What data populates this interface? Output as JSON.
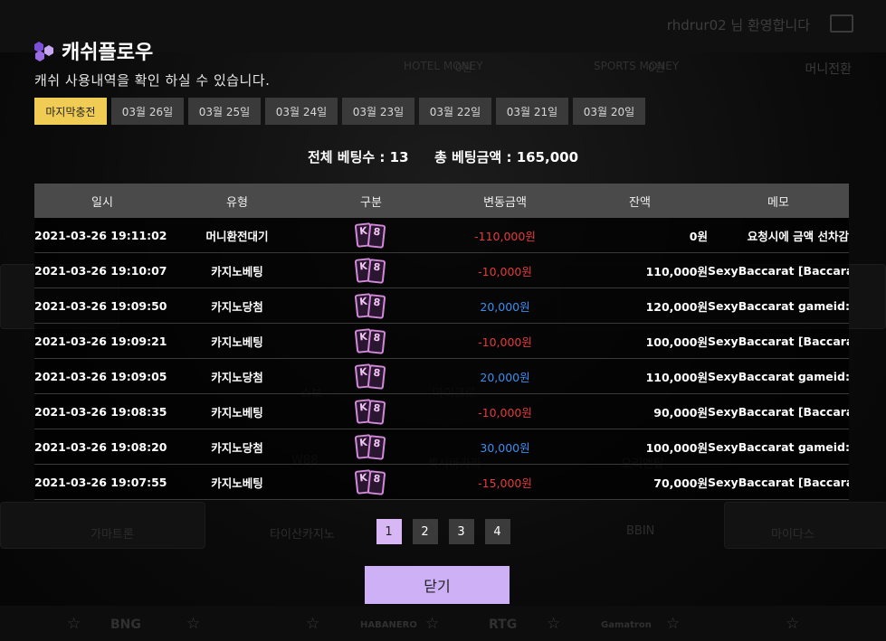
{
  "background": {
    "welcome": "rhdrur02 님 환영합니다",
    "wallets": [
      "HOTEL MONEY",
      "0원",
      "SPORTS MONEY",
      "0원"
    ],
    "exchange": "머니전환",
    "tiles": [
      "스보",
      "마이크로",
      "W88",
      "섹시바카라",
      "오리엔탈",
      "가마트론",
      "타이산카지노",
      "BBIN",
      "마이다스"
    ],
    "footer_logos": [
      "BNG",
      "HABANERO",
      "RTG",
      "Gamatron"
    ]
  },
  "modal": {
    "title": "캐쉬플로우",
    "subtitle": "캐쉬 사용내역을 확인 하실 수 있습니다.",
    "tabs": [
      {
        "label": "마지막충전",
        "active": true
      },
      {
        "label": "03월 26일"
      },
      {
        "label": "03월 25일"
      },
      {
        "label": "03월 24일"
      },
      {
        "label": "03월 23일"
      },
      {
        "label": "03월 22일"
      },
      {
        "label": "03월 21일"
      },
      {
        "label": "03월 20일"
      }
    ],
    "summary": {
      "bet_count_label": "전체 베팅수 :",
      "bet_count": "13",
      "bet_total_label": "총 베팅금액 :",
      "bet_total": "165,000"
    },
    "table": {
      "headers": [
        "일시",
        "유형",
        "구분",
        "변동금액",
        "잔액",
        "메모"
      ],
      "rows": [
        {
          "date": "2021-03-26 19:11:02",
          "type": "머니환전대기",
          "amount": "-110,000원",
          "sign": "neg",
          "balance": "0원",
          "memo": "요청시에 금액 선차감"
        },
        {
          "date": "2021-03-26 19:10:07",
          "type": "카지노베팅",
          "amount": "-10,000원",
          "sign": "neg",
          "balance": "110,000원",
          "memo": "SexyBaccarat [Baccarat"
        },
        {
          "date": "2021-03-26 19:09:50",
          "type": "카지노당첨",
          "amount": "20,000원",
          "sign": "pos",
          "balance": "120,000원",
          "memo": "SexyBaccarat gameid:M"
        },
        {
          "date": "2021-03-26 19:09:21",
          "type": "카지노베팅",
          "amount": "-10,000원",
          "sign": "neg",
          "balance": "100,000원",
          "memo": "SexyBaccarat [Baccarat"
        },
        {
          "date": "2021-03-26 19:09:05",
          "type": "카지노당첨",
          "amount": "20,000원",
          "sign": "pos",
          "balance": "110,000원",
          "memo": "SexyBaccarat gameid:M"
        },
        {
          "date": "2021-03-26 19:08:35",
          "type": "카지노베팅",
          "amount": "-10,000원",
          "sign": "neg",
          "balance": "90,000원",
          "memo": "SexyBaccarat [Baccarat"
        },
        {
          "date": "2021-03-26 19:08:20",
          "type": "카지노당첨",
          "amount": "30,000원",
          "sign": "pos",
          "balance": "100,000원",
          "memo": "SexyBaccarat gameid:M"
        },
        {
          "date": "2021-03-26 19:07:55",
          "type": "카지노베팅",
          "amount": "-15,000원",
          "sign": "neg",
          "balance": "70,000원",
          "memo": "SexyBaccarat [Baccarat"
        }
      ]
    },
    "pagination": {
      "pages": [
        "1",
        "2",
        "3",
        "4"
      ],
      "current": "1"
    },
    "close_label": "닫기",
    "card_icon_text": [
      "K",
      "8"
    ],
    "colors": {
      "accent_tab": "#f0cc55",
      "button": "#cdb0f5",
      "negative": "#e23a3a",
      "positive": "#3a8ef0"
    }
  }
}
